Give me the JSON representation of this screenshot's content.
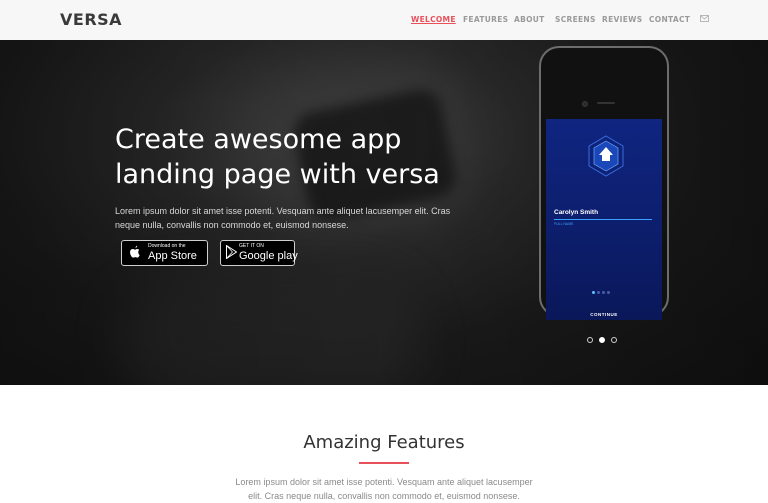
{
  "brand": "VERSA",
  "nav": {
    "items": [
      "WELCOME",
      "FEATURES",
      "ABOUT",
      "SCREENS",
      "REVIEWS",
      "CONTACT"
    ],
    "active": "WELCOME",
    "mail_icon": "envelope-icon"
  },
  "hero": {
    "headline_line1": "Create awesome app",
    "headline_line2": "landing page with versa",
    "text": "Lorem ipsum dolor sit amet isse potenti. Vesquam ante aliquet lacusemper elit. Cras neque nulla, convallis non commodo et, euismod nonsese.",
    "appstore": {
      "small": "Download on the",
      "big": "App Store",
      "icon": "apple-icon"
    },
    "googleplay": {
      "small": "GET IT ON",
      "big": "Google play",
      "icon": "play-icon"
    }
  },
  "phone": {
    "user_name": "Carolyn Smith",
    "field_label": "FULL NAME",
    "continue_label": "CONTINUE",
    "pager_dots": 4,
    "active_pager_dot": 0,
    "slider_dots": 3,
    "active_slider_dot": 1
  },
  "features": {
    "title": "Amazing Features",
    "text": "Lorem ipsum dolor sit amet isse potenti. Vesquam ante aliquet lacusemper elit. Cras neque nulla, convallis non commodo et, euismod nonsese."
  },
  "colors": {
    "accent": "#e8505b",
    "screen": "#0f2580",
    "highlight": "#3aa0ff"
  }
}
